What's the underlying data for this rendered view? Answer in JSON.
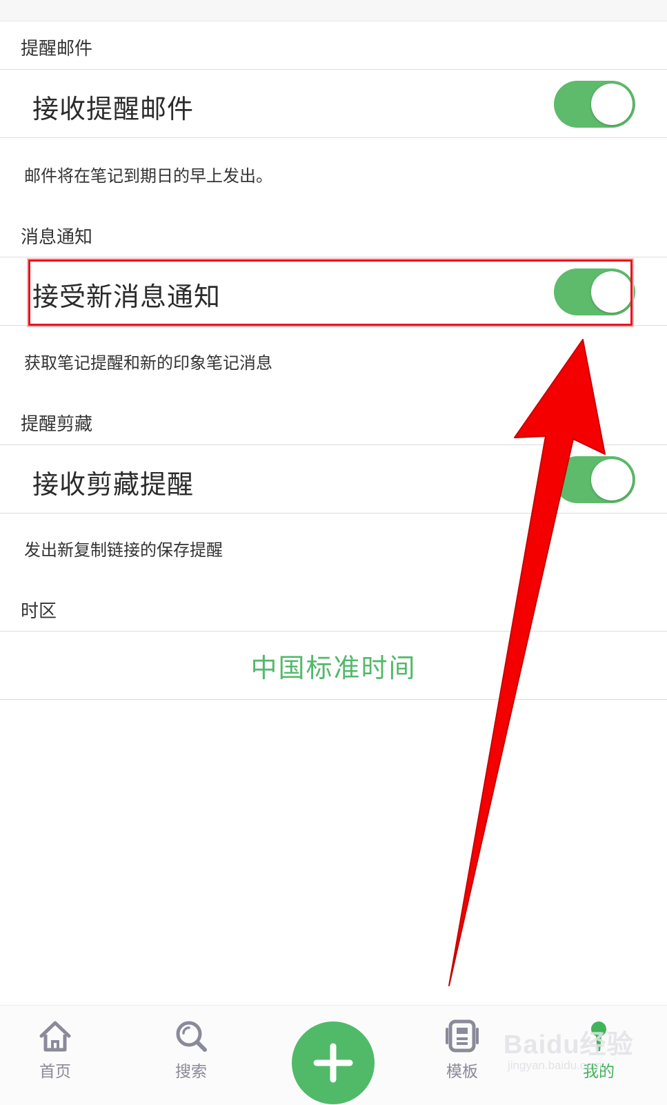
{
  "sections": {
    "reminder_email": {
      "header": "提醒邮件",
      "row_label": "接收提醒邮件",
      "toggle_on": true,
      "description": "邮件将在笔记到期日的早上发出。"
    },
    "notifications": {
      "header": "消息通知",
      "row_label": "接受新消息通知",
      "toggle_on": true,
      "description": "获取笔记提醒和新的印象笔记消息"
    },
    "clip_reminder": {
      "header": "提醒剪藏",
      "row_label": "接收剪藏提醒",
      "toggle_on": true,
      "description": "发出新复制链接的保存提醒"
    },
    "timezone": {
      "header": "时区",
      "value": "中国标准时间"
    }
  },
  "bottom_nav": {
    "home": "首页",
    "search": "搜索",
    "templates": "模板",
    "mine": "我的",
    "add_icon": "plus-icon"
  },
  "watermark": {
    "brand": "Baidu经验",
    "url": "jingyan.baidu.com"
  },
  "colors": {
    "accent_green": "#52b96a",
    "toggle_on": "#5dbb6b",
    "annotation_red": "#e8141d",
    "nav_inactive": "#8a8a9a"
  }
}
